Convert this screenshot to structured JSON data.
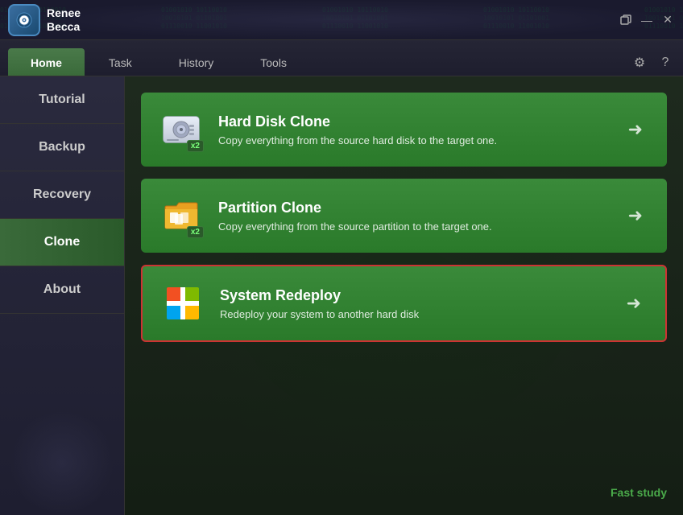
{
  "app": {
    "name_line1": "Renee",
    "name_line2": "Becca"
  },
  "title_controls": {
    "restore": "🗘",
    "minimize": "—",
    "close": "✕"
  },
  "nav": {
    "tabs": [
      {
        "label": "Home",
        "active": true
      },
      {
        "label": "Task",
        "active": false
      },
      {
        "label": "History",
        "active": false
      },
      {
        "label": "Tools",
        "active": false
      }
    ],
    "settings_icon": "⚙",
    "help_icon": "?"
  },
  "sidebar": {
    "items": [
      {
        "label": "Tutorial",
        "active": false
      },
      {
        "label": "Backup",
        "active": false
      },
      {
        "label": "Recovery",
        "active": false
      },
      {
        "label": "Clone",
        "active": true
      },
      {
        "label": "About",
        "active": false
      }
    ]
  },
  "cards": [
    {
      "id": "hard-disk-clone",
      "title": "Hard Disk Clone",
      "description": "Copy everything from the source hard disk to the target one.",
      "badge": "x2",
      "highlighted": false
    },
    {
      "id": "partition-clone",
      "title": "Partition Clone",
      "description": "Copy everything from the source partition to the target one.",
      "badge": "x2",
      "highlighted": false
    },
    {
      "id": "system-redeploy",
      "title": "System Redeploy",
      "description": "Redeploy your system to another hard disk",
      "badge": null,
      "highlighted": true
    }
  ],
  "footer": {
    "fast_study": "Fast study"
  }
}
